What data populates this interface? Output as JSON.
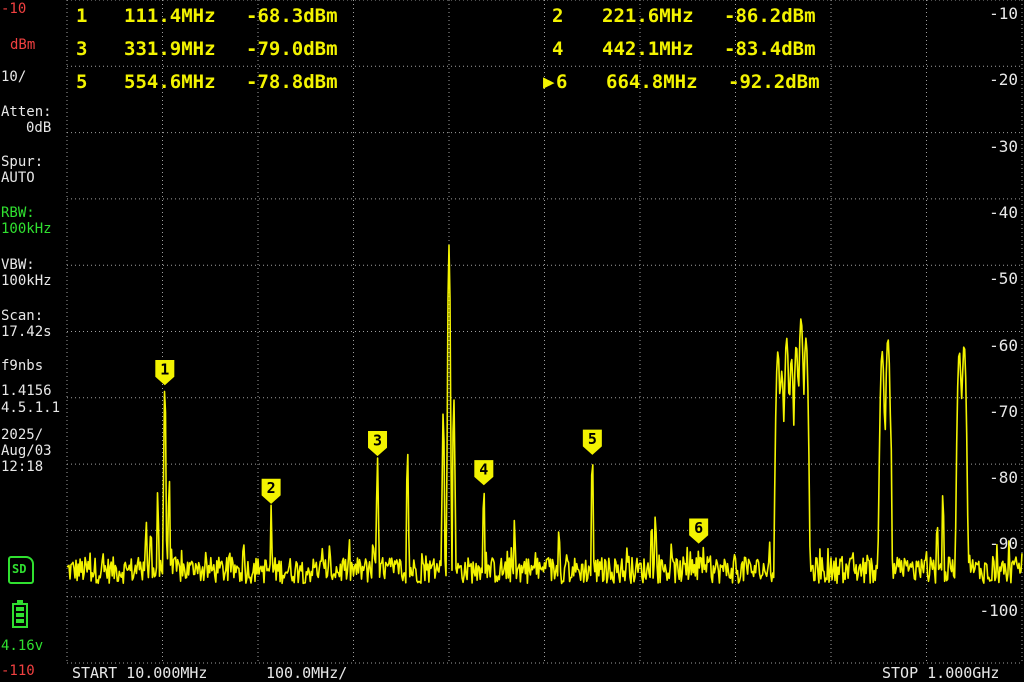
{
  "left_panel": {
    "ref_level": "-10",
    "unit": "dBm",
    "scale": "10/",
    "atten_label": "Atten:",
    "atten_value": "0dB",
    "spur_label": "Spur:",
    "spur_value": "AUTO",
    "rbw_label": "RBW:",
    "rbw_value": "100kHz",
    "vbw_label": "VBW:",
    "vbw_value": "100kHz",
    "scan_label": "Scan:",
    "scan_value": "17.42s",
    "device_name": "f9nbs",
    "version_1": "1.4156",
    "version_2": "4.5.1.1",
    "date_year": "2025/",
    "date_day": "Aug/03",
    "time": "12:18",
    "sd_icon_text": "SD",
    "battery_voltage": "4.16v",
    "bottom_level": "-110"
  },
  "footer": {
    "start": "START 10.000MHz",
    "per_div": "100.0MHz/",
    "stop": "STOP 1.000GHz"
  },
  "markers": [
    {
      "num": "1",
      "freq": "111.4MHz",
      "level": "-68.3dBm",
      "active": false
    },
    {
      "num": "2",
      "freq": "221.6MHz",
      "level": "-86.2dBm",
      "active": false
    },
    {
      "num": "3",
      "freq": "331.9MHz",
      "level": "-79.0dBm",
      "active": false
    },
    {
      "num": "4",
      "freq": "442.1MHz",
      "level": "-83.4dBm",
      "active": false
    },
    {
      "num": "5",
      "freq": "554.6MHz",
      "level": "-78.8dBm",
      "active": false
    },
    {
      "num": "6",
      "freq": "664.8MHz",
      "level": "-92.2dBm",
      "active": true
    }
  ],
  "colors": {
    "trace": "#f3f300",
    "grid": "#a0a0a0",
    "text": "#e8e8e8",
    "ref_red": "#f04040",
    "green": "#30e030"
  },
  "chart_data": {
    "type": "line",
    "title": "",
    "xlabel": "",
    "ylabel": "dBm",
    "xlim": [
      10,
      1000
    ],
    "ylim": [
      -110,
      -10
    ],
    "x_unit": "MHz",
    "y_tick_labels": [
      "-10",
      "-20",
      "-30",
      "-40",
      "-50",
      "-60",
      "-70",
      "-80",
      "-90",
      "-100"
    ],
    "grid": true,
    "noise_floor_dbm": -96,
    "series": [
      {
        "peaks": [
          {
            "x": 92,
            "y": -88
          },
          {
            "x": 97,
            "y": -89
          },
          {
            "x": 104,
            "y": -84
          },
          {
            "x": 111.4,
            "y": -68.3
          },
          {
            "x": 116,
            "y": -82
          },
          {
            "x": 221.6,
            "y": -86.2
          },
          {
            "x": 331.9,
            "y": -79.0
          },
          {
            "x": 363,
            "y": -78
          },
          {
            "x": 400,
            "y": -72
          },
          {
            "x": 406,
            "y": -47
          },
          {
            "x": 411,
            "y": -70
          },
          {
            "x": 442.1,
            "y": -83.4
          },
          {
            "x": 474,
            "y": -88
          },
          {
            "x": 520,
            "y": -89
          },
          {
            "x": 554.6,
            "y": -78.8
          },
          {
            "x": 616,
            "y": -88
          },
          {
            "x": 620,
            "y": -87
          },
          {
            "x": 664.8,
            "y": -92.2
          },
          {
            "x": 747,
            "y": -63
          },
          {
            "x": 751,
            "y": -66
          },
          {
            "x": 756,
            "y": -61
          },
          {
            "x": 761,
            "y": -64
          },
          {
            "x": 766,
            "y": -62
          },
          {
            "x": 771,
            "y": -58
          },
          {
            "x": 776,
            "y": -61
          },
          {
            "x": 855,
            "y": -63
          },
          {
            "x": 861,
            "y": -61
          },
          {
            "x": 912,
            "y": -88
          },
          {
            "x": 918,
            "y": -84
          },
          {
            "x": 935,
            "y": -63
          },
          {
            "x": 940,
            "y": -62
          }
        ]
      }
    ],
    "markers": [
      {
        "label": "1",
        "x": 111.4,
        "y": -68.3
      },
      {
        "label": "2",
        "x": 221.6,
        "y": -86.2
      },
      {
        "label": "3",
        "x": 331.9,
        "y": -79.0
      },
      {
        "label": "4",
        "x": 442.1,
        "y": -83.4
      },
      {
        "label": "5",
        "x": 554.6,
        "y": -78.8
      },
      {
        "label": "6",
        "x": 664.8,
        "y": -92.2
      }
    ]
  }
}
